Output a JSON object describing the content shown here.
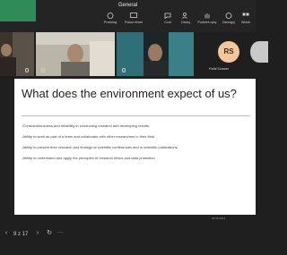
{
  "window": {
    "title": "General"
  },
  "toolbar": {
    "items": [
      {
        "label": "Przebieg",
        "icon": "timer-icon"
      },
      {
        "label": "Pokaż ekran",
        "icon": "share-screen-icon"
      },
      {
        "label": "Czat",
        "icon": "chat-icon"
      },
      {
        "label": "Osoby",
        "icon": "people-icon"
      },
      {
        "label": "Podnieś rękę",
        "icon": "raise-hand-icon"
      },
      {
        "label": "Zareaguj",
        "icon": "react-icon"
      },
      {
        "label": "Widok",
        "icon": "view-icon"
      }
    ]
  },
  "participants": [
    {
      "name": "",
      "kind": "video"
    },
    {
      "name": "",
      "kind": "video"
    },
    {
      "name": "",
      "kind": "video"
    },
    {
      "name": "Rafał Szawan",
      "initials": "RS",
      "kind": "avatar"
    }
  ],
  "slide": {
    "title": "What does the environment expect of us?",
    "bullets": [
      "-Conscientiousness and reliability in conducting research and developing results.",
      "-Ability to work as part of a team and collaborate with other researchers in their field.",
      "-Ability to present their research and findings at scientific conferences and in scientific publications.",
      "-Ability to understand and apply the principles of research ethics and data protection"
    ]
  },
  "footer_date": "09.05.2023",
  "bottom": {
    "page_indicator": "9 z 17",
    "more": "···"
  },
  "colors": {
    "accent": "#2e8b57",
    "avatar_bg": "#f3c79a"
  }
}
